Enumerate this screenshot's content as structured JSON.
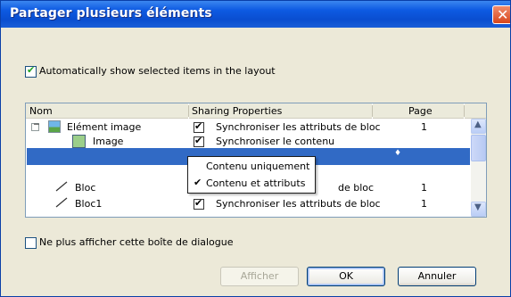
{
  "dialog": {
    "title": "Partager plusieurs éléments",
    "auto_show_label": "Automatically show selected items in the layout",
    "auto_show_checked": true,
    "no_show_label": "Ne plus afficher cette boîte de dialogue",
    "no_show_checked": false
  },
  "table": {
    "headers": {
      "name": "Nom",
      "sharing": "Sharing Properties",
      "page": "Page"
    },
    "rows": [
      {
        "name": "Elément image",
        "sharing": "Synchroniser les attributs de bloc",
        "page": "1",
        "checked": true
      },
      {
        "name": "Image",
        "sharing": "Synchroniser le contenu",
        "page": "",
        "checked": true
      },
      {
        "name": "",
        "sharing": "",
        "page": "",
        "selected": true
      },
      {
        "name": "Bloc",
        "sharing": "de bloc",
        "page": "1",
        "checked": true
      },
      {
        "name": "Bloc1",
        "sharing": "Synchroniser les attributs de bloc",
        "page": "1",
        "checked": true
      }
    ]
  },
  "dropdown": {
    "options": [
      "Contenu uniquement",
      "Contenu et attributs"
    ],
    "selected_index": 1
  },
  "buttons": {
    "show": "Afficher",
    "ok": "OK",
    "cancel": "Annuler"
  },
  "colors": {
    "titlebar": "#0a4ed0",
    "selection": "#316ac5",
    "dialog_bg": "#ece9d8"
  }
}
